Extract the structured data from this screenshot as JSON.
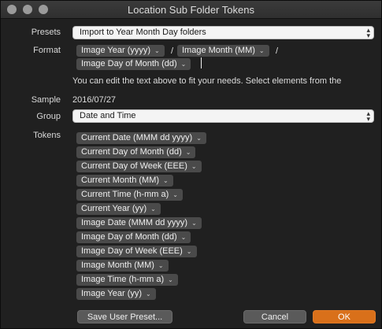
{
  "window": {
    "title": "Location Sub Folder Tokens"
  },
  "presets": {
    "label": "Presets",
    "value": "Import to Year Month Day folders"
  },
  "format": {
    "label": "Format",
    "tokens": [
      "Image Year (yyyy)",
      "Image Month (MM)",
      "Image Day of Month (dd)"
    ],
    "separator": "/"
  },
  "hint": "You can edit the text above to fit your needs. Select elements from the",
  "sample": {
    "label": "Sample",
    "value": "2016/07/27"
  },
  "group": {
    "label": "Group",
    "value": "Date and Time"
  },
  "tokens": {
    "label": "Tokens",
    "items": [
      "Current Date (MMM dd yyyy)",
      "Current Day of Month (dd)",
      "Current Day of Week (EEE)",
      "Current Month (MM)",
      "Current Time (h-mm a)",
      "Current Year (yy)",
      "Image Date (MMM dd yyyy)",
      "Image Day of Month (dd)",
      "Image Day of Week (EEE)",
      "Image Month (MM)",
      "Image Time (h-mm a)",
      "Image Year (yy)"
    ]
  },
  "buttons": {
    "save_preset": "Save User Preset...",
    "cancel": "Cancel",
    "ok": "OK"
  },
  "icons": {
    "token_menu": "chevron-down-icon",
    "popup": "updown-arrows-icon"
  },
  "colors": {
    "ok_button": "#d9701a",
    "token_bg": "#4a4a4a"
  }
}
